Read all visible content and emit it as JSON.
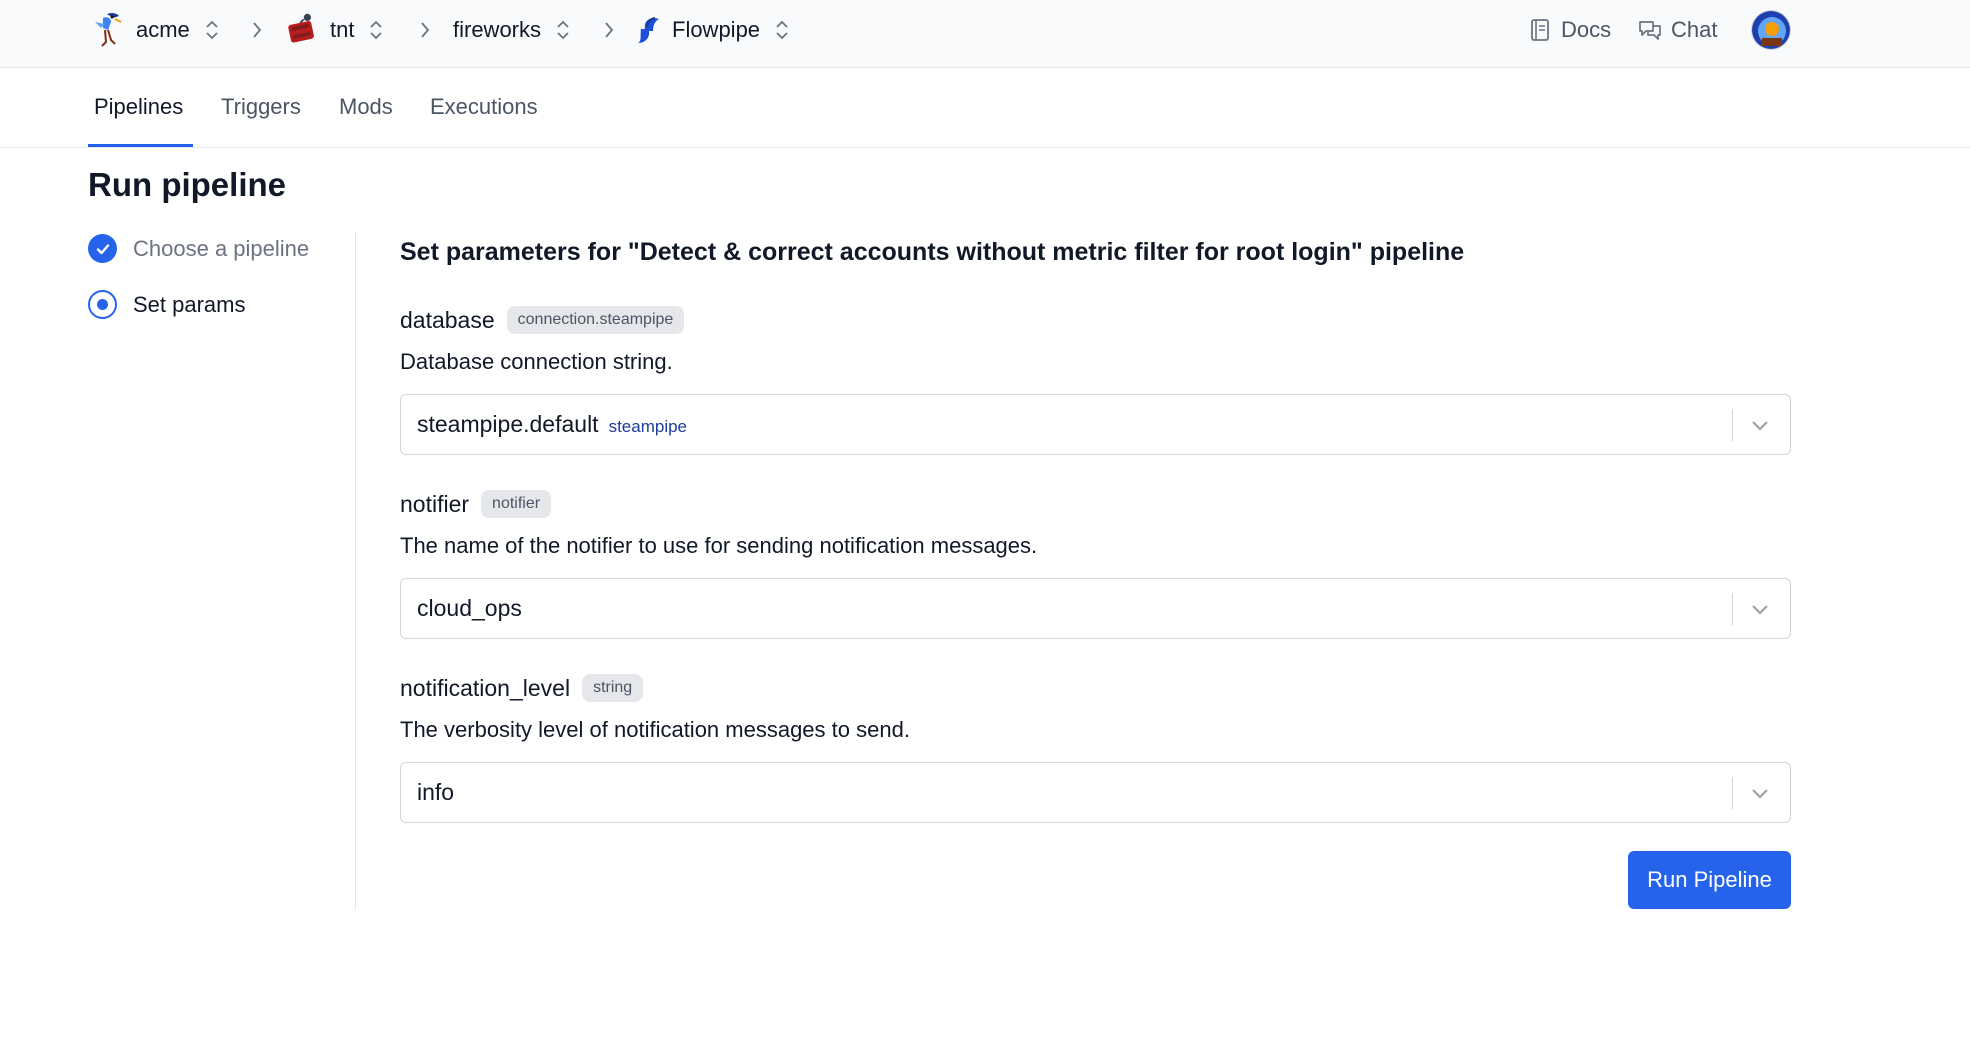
{
  "breadcrumb": [
    {
      "name": "acme",
      "icon": "roadrunner-logo-icon"
    },
    {
      "name": "tnt",
      "icon": "tnt-crate-logo-icon"
    },
    {
      "name": "fireworks",
      "icon": ""
    },
    {
      "name": "Flowpipe",
      "icon": "flowpipe-logo-icon"
    }
  ],
  "header": {
    "docs_label": "Docs",
    "chat_label": "Chat"
  },
  "tabs": [
    {
      "label": "Pipelines",
      "active": true
    },
    {
      "label": "Triggers",
      "active": false
    },
    {
      "label": "Mods",
      "active": false
    },
    {
      "label": "Executions",
      "active": false
    }
  ],
  "page": {
    "title": "Run pipeline"
  },
  "steps": [
    {
      "label": "Choose a pipeline",
      "state": "complete"
    },
    {
      "label": "Set params",
      "state": "current"
    }
  ],
  "form": {
    "heading": "Set parameters for \"Detect & correct accounts without metric filter for root login\" pipeline",
    "params": [
      {
        "name": "database",
        "type": "connection.steampipe",
        "description": "Database connection string.",
        "value": "steampipe.default",
        "value_sub": "steampipe"
      },
      {
        "name": "notifier",
        "type": "notifier",
        "description": "The name of the notifier to use for sending notification messages.",
        "value": "cloud_ops",
        "value_sub": ""
      },
      {
        "name": "notification_level",
        "type": "string",
        "description": "The verbosity level of notification messages to send.",
        "value": "info",
        "value_sub": ""
      }
    ],
    "submit_label": "Run Pipeline"
  },
  "colors": {
    "accent": "#2563eb",
    "step_complete": "#2563eb",
    "muted_text": "#4b5563",
    "badge_bg": "#e5e7eb"
  }
}
